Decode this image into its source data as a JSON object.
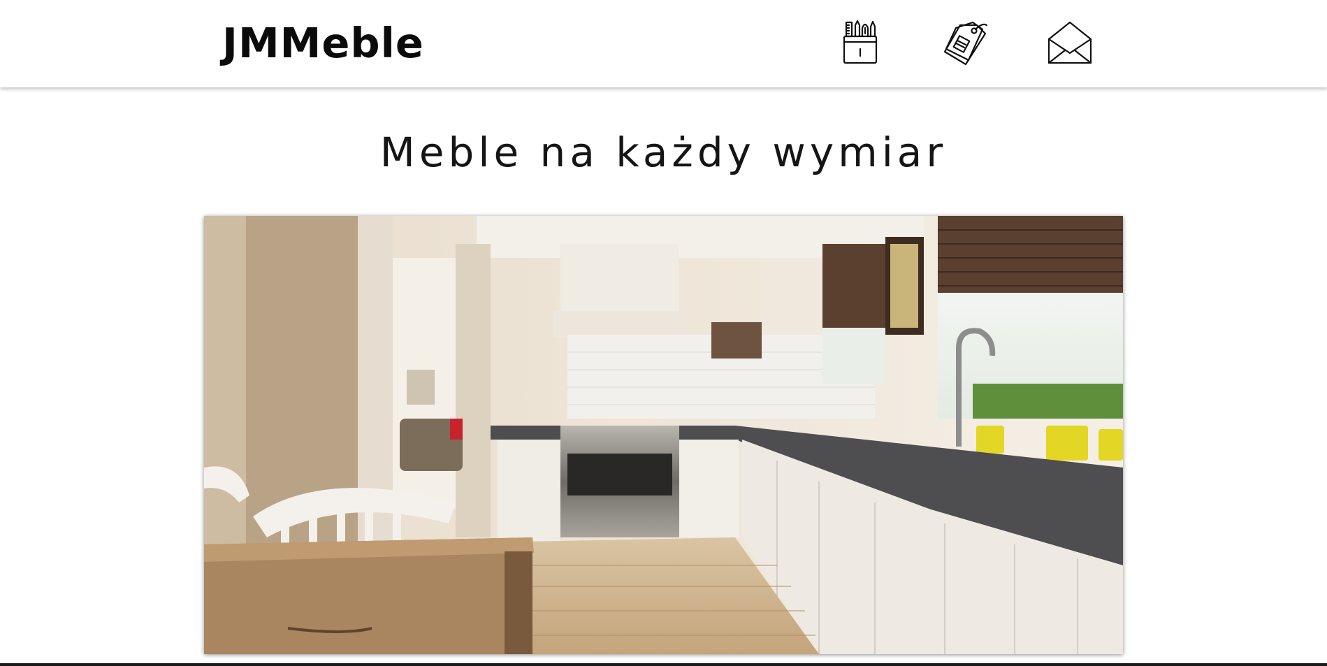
{
  "header": {
    "logo_text": "JMMeble",
    "nav": [
      {
        "icon": "tools-cup-icon"
      },
      {
        "icon": "price-tags-icon"
      },
      {
        "icon": "envelope-icon"
      }
    ]
  },
  "main": {
    "title": "Meble na każdy wymiar",
    "hero_image": {
      "subject": "bright kitchen interior with white cabinets, stainless oven, wooden table and window with blinds"
    }
  },
  "colors": {
    "background": "#ffffff",
    "text": "#111111",
    "header_shadow": "#c8c8c8"
  }
}
